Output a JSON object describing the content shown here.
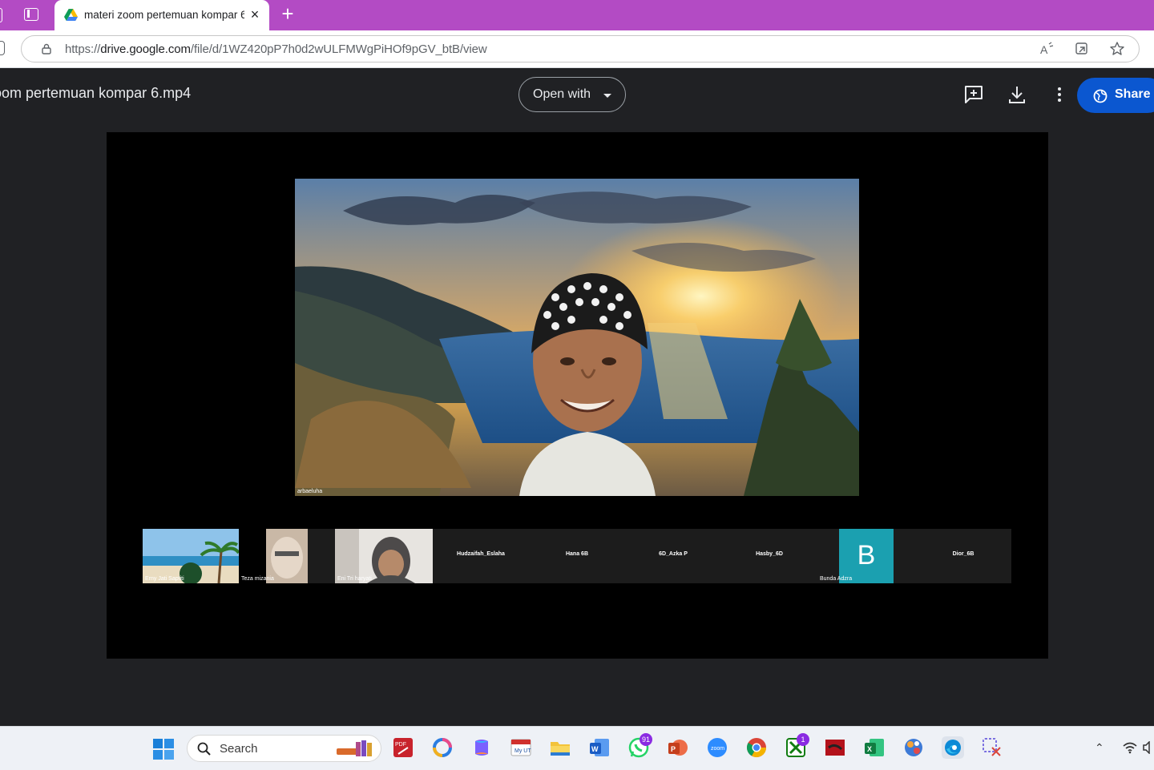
{
  "browser": {
    "tab_title": "materi zoom pertemuan kompar 6.mp4",
    "new_tab_label": "+",
    "close_label": "×",
    "url_prefix": "https://",
    "url_host": "drive.google.com",
    "url_path": "/file/d/1WZ420pP7h0d2wULFMWgPiHOf9pGV_btB/view"
  },
  "viewer": {
    "file_name": "oom pertemuan kompar 6.mp4",
    "open_with_label": "Open with",
    "share_label": "Share"
  },
  "video": {
    "speaker_name": "arbaeluha",
    "participants": [
      {
        "name": "Erny Jati Saptiti"
      },
      {
        "name": "Teza mizania"
      },
      {
        "name": "Eni Tri haryati"
      },
      {
        "name": "Hudzaifah_Eslaha"
      },
      {
        "name": "Hana 6B"
      },
      {
        "name": "6D_Azka P"
      },
      {
        "name": "Hasby_6D"
      },
      {
        "name": "Bunda Adzra",
        "initial": "B"
      },
      {
        "name": "Dior_6B"
      }
    ]
  },
  "taskbar": {
    "search_label": "Search",
    "whatsapp_badge": "91",
    "xbox_badge": "1",
    "apps": [
      "start-icon",
      "search",
      "books-icon",
      "pdf-icon",
      "copilot-app-icon",
      "copilot-icon",
      "myut-icon",
      "file-explorer-icon",
      "word-icon",
      "whatsapp-icon",
      "powerpoint-icon",
      "zoom-icon",
      "chrome-icon",
      "xbox-icon",
      "red-app-icon",
      "excel-icon",
      "network-app-icon",
      "edge-icon",
      "snipping-tool-icon"
    ]
  },
  "colors": {
    "tabstrip": "#b34bc4",
    "share_button": "#0b57d0",
    "avatar_teal": "#1ba0b0"
  }
}
